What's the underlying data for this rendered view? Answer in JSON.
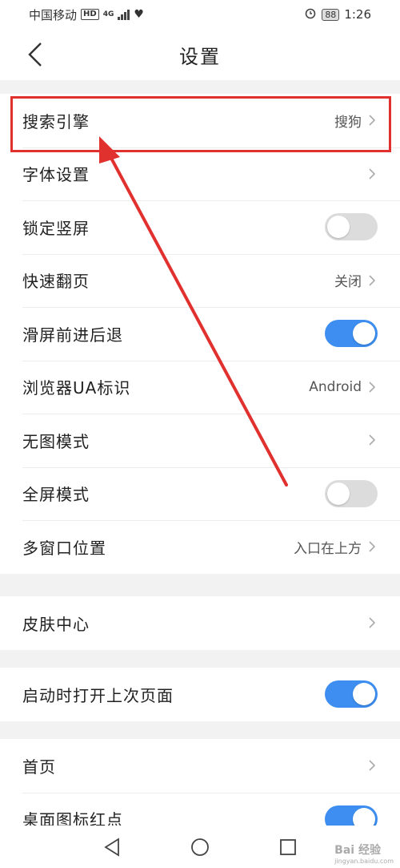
{
  "statusbar": {
    "carrier": "中国移动",
    "hd": "HD",
    "net": "4G",
    "battery": "88",
    "time": "1:26"
  },
  "header": {
    "title": "设置"
  },
  "groups": [
    {
      "rows": [
        {
          "label": "搜索引擎",
          "value": "搜狗"
        },
        {
          "label": "字体设置",
          "value": ""
        },
        {
          "label": "锁定竖屏",
          "toggle": false
        },
        {
          "label": "快速翻页",
          "value": "关闭"
        },
        {
          "label": "滑屏前进后退",
          "toggle": true
        },
        {
          "label": "浏览器UA标识",
          "value": "Android"
        },
        {
          "label": "无图模式",
          "value": ""
        },
        {
          "label": "全屏模式",
          "toggle": false
        },
        {
          "label": "多窗口位置",
          "value": "入口在上方"
        }
      ]
    },
    {
      "rows": [
        {
          "label": "皮肤中心",
          "value": ""
        }
      ]
    },
    {
      "rows": [
        {
          "label": "启动时打开上次页面",
          "toggle": true
        }
      ]
    },
    {
      "rows": [
        {
          "label": "首页",
          "value": ""
        },
        {
          "label": "桌面图标红点",
          "toggle": true
        }
      ]
    }
  ],
  "watermark": {
    "text": "Bai 经验",
    "sub": "jingyan.baidu.com"
  },
  "colors": {
    "accent": "#3d8ef0",
    "annotation": "#e0312f",
    "toggle_off": "#dcdcdc"
  }
}
